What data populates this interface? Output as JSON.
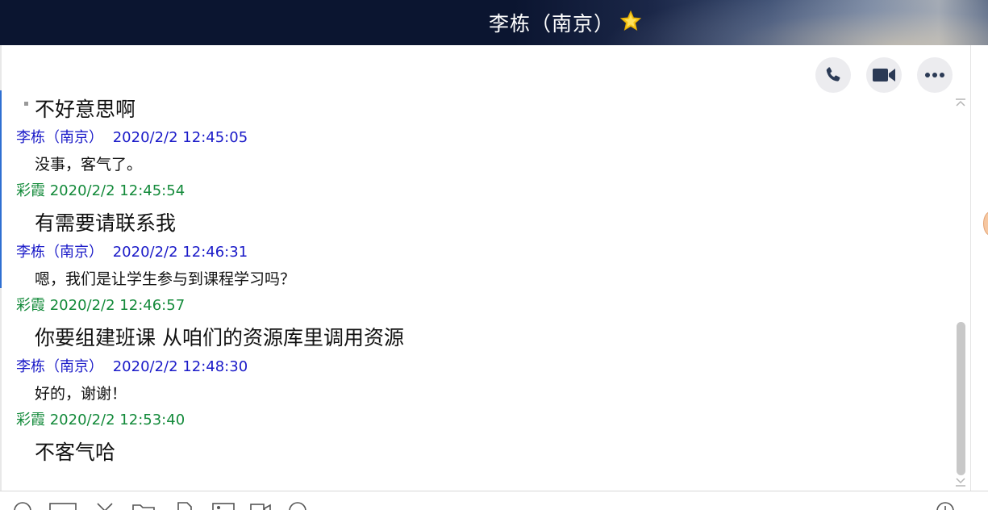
{
  "window": {
    "title": "李栋（南京）",
    "favorite_icon": "star-icon"
  },
  "actions": {
    "call_icon": "phone-icon",
    "video_icon": "video-icon",
    "more_icon": "more-icon"
  },
  "messages": [
    {
      "text": "不好意思啊",
      "style": "big"
    },
    {
      "sender": "李栋（南京）",
      "time": "2020/2/2 12:45:05",
      "text": "没事，客气了。",
      "style": "small"
    },
    {
      "sender": "彩霞",
      "time": "2020/2/2 12:45:54",
      "text": "有需要请联系我",
      "style": "big"
    },
    {
      "sender": "李栋（南京）",
      "time": "2020/2/2 12:46:31",
      "text": "嗯，我们是让学生参与到课程学习吗？",
      "style": "small"
    },
    {
      "sender": "彩霞",
      "time": "2020/2/2 12:46:57",
      "text": "你要组建班课 从咱们的资源库里调用资源",
      "style": "big"
    },
    {
      "sender": "李栋（南京）",
      "time": "2020/2/2 12:48:30",
      "text": "好的，谢谢！",
      "style": "small"
    },
    {
      "sender": "彩霞",
      "time": "2020/2/2 12:53:40",
      "text": "不客气哈",
      "style": "big"
    }
  ],
  "colors": {
    "sender_li": "#1a1ac8",
    "sender_cai": "#138a3a",
    "titlebar_bg": "#0b1530",
    "action_btn_bg": "#ececef"
  },
  "toolbar_icons": [
    "emoji-icon",
    "screenshot-icon",
    "scissors-icon",
    "folder-icon",
    "document-icon",
    "image-icon",
    "camera-icon",
    "voice-icon",
    "history-icon"
  ]
}
